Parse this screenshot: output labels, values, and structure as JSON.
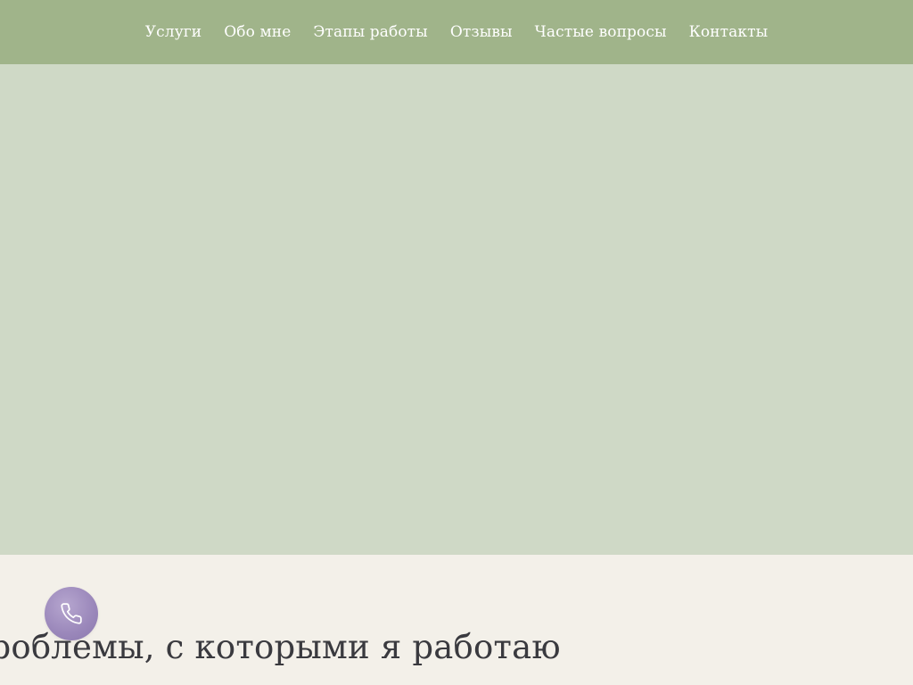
{
  "nav": {
    "items": [
      {
        "label": "Услуги"
      },
      {
        "label": "Обо мне"
      },
      {
        "label": "Этапы работы"
      },
      {
        "label": "Отзывы"
      },
      {
        "label": "Частые вопросы"
      },
      {
        "label": "Контакты"
      }
    ]
  },
  "section": {
    "heading": "Проблемы, с которыми я работаю"
  },
  "call_button": {
    "icon": "phone-icon"
  },
  "colors": {
    "nav_bg": "#a0b48a",
    "hero_bg": "#cfd9c6",
    "page_bg": "#f3f0e9",
    "heading_text": "#3a3a3f",
    "call_button": "#9a87ba"
  }
}
